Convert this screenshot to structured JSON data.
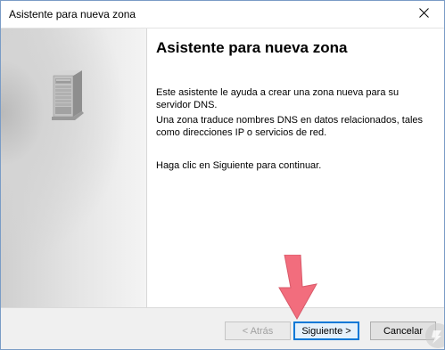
{
  "window": {
    "title": "Asistente para nueva zona"
  },
  "icons": {
    "server": "server-icon",
    "close": "close-icon",
    "arrow": "arrow-down-icon",
    "watermark": "logo-watermark-icon"
  },
  "content": {
    "heading": "Asistente para nueva zona",
    "paragraph1": "Este asistente le ayuda a crear una zona nueva para su servidor DNS.",
    "paragraph2": "Una zona traduce nombres DNS en datos relacionados, tales como direcciones IP o servicios de red.",
    "paragraph3": "Haga clic en Siguiente para continuar."
  },
  "buttons": {
    "back": "< Atrás",
    "next": "Siguiente >",
    "cancel": "Cancelar"
  },
  "colors": {
    "accent": "#0078d7",
    "arrow": "#f26d7d"
  }
}
